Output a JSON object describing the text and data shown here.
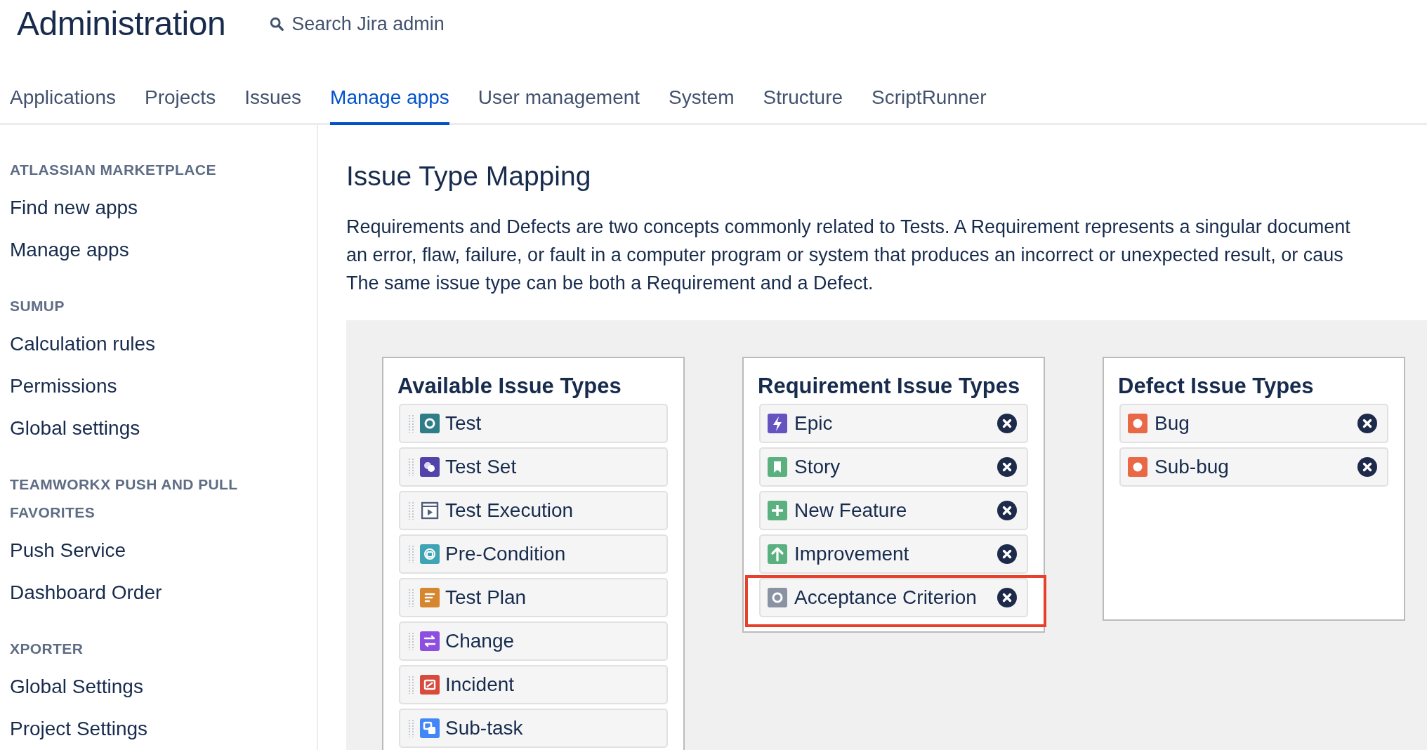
{
  "header": {
    "title": "Administration",
    "search": {
      "placeholder": "Search Jira admin"
    }
  },
  "tabs": [
    {
      "label": "Applications",
      "selected": false
    },
    {
      "label": "Projects",
      "selected": false
    },
    {
      "label": "Issues",
      "selected": false
    },
    {
      "label": "Manage apps",
      "selected": true
    },
    {
      "label": "User management",
      "selected": false
    },
    {
      "label": "System",
      "selected": false
    },
    {
      "label": "Structure",
      "selected": false
    },
    {
      "label": "ScriptRunner",
      "selected": false
    }
  ],
  "sidebar": {
    "sections": [
      {
        "heading": "ATLASSIAN MARKETPLACE",
        "items": [
          "Find new apps",
          "Manage apps"
        ]
      },
      {
        "heading": "SUMUP",
        "items": [
          "Calculation rules",
          "Permissions",
          "Global settings"
        ]
      },
      {
        "heading": "TEAMWORKX PUSH AND PULL FAVORITES",
        "items": [
          "Push Service",
          "Dashboard Order"
        ]
      },
      {
        "heading": "XPORTER",
        "items": [
          "Global Settings",
          "Project Settings"
        ]
      }
    ]
  },
  "page": {
    "heading": "Issue Type Mapping",
    "description_lines": [
      "Requirements and Defects are two concepts commonly related to Tests. A Requirement represents a singular document",
      "an error, flaw, failure, or fault in a computer program or system that produces an incorrect or unexpected result, or caus",
      "The same issue type can be both a Requirement and a Defect."
    ],
    "columns": [
      {
        "title": "Available Issue Types",
        "kind": "available",
        "items": [
          {
            "label": "Test",
            "kind": "ring",
            "color": "#2f7d87",
            "highlighted": false
          },
          {
            "label": "Test Set",
            "kind": "blobs",
            "color": "#5243aa",
            "highlighted": false
          },
          {
            "label": "Test Execution",
            "kind": "play",
            "color": "#505f79",
            "highlighted": false
          },
          {
            "label": "Pre-Condition",
            "kind": "copy",
            "color": "#3fa5b5",
            "highlighted": false
          },
          {
            "label": "Test Plan",
            "kind": "lines",
            "color": "#d6862e",
            "highlighted": false
          },
          {
            "label": "Change",
            "kind": "swap",
            "color": "#8c4fe0",
            "highlighted": false
          },
          {
            "label": "Incident",
            "kind": "slash",
            "color": "#d9493c",
            "highlighted": false
          },
          {
            "label": "Sub-task",
            "kind": "subtask",
            "color": "#4287f5",
            "highlighted": false
          }
        ]
      },
      {
        "title": "Requirement Issue Types",
        "kind": "mapped",
        "items": [
          {
            "label": "Epic",
            "kind": "bolt",
            "color": "#6554c0",
            "highlighted": false
          },
          {
            "label": "Story",
            "kind": "bookmark",
            "color": "#5ab07f",
            "highlighted": false
          },
          {
            "label": "New Feature",
            "kind": "plus",
            "color": "#5ab07f",
            "highlighted": false
          },
          {
            "label": "Improvement",
            "kind": "arrow",
            "color": "#5ab07f",
            "highlighted": false
          },
          {
            "label": "Acceptance Criterion",
            "kind": "ring",
            "color": "#8993a4",
            "highlighted": true
          }
        ]
      },
      {
        "title": "Defect Issue Types",
        "kind": "mapped",
        "items": [
          {
            "label": "Bug",
            "kind": "dot",
            "color": "#e96845",
            "highlighted": false
          },
          {
            "label": "Sub-bug",
            "kind": "dot",
            "color": "#e96845",
            "highlighted": false
          }
        ]
      }
    ]
  }
}
